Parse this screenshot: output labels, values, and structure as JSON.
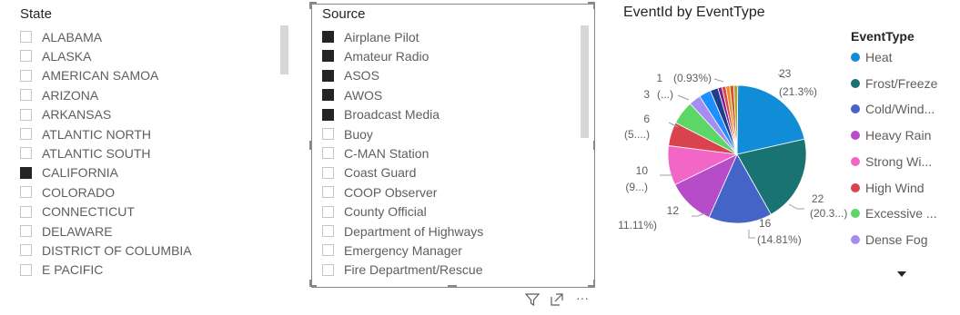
{
  "state_slicer": {
    "title": "State",
    "items": [
      {
        "label": "ALABAMA",
        "checked": false
      },
      {
        "label": "ALASKA",
        "checked": false
      },
      {
        "label": "AMERICAN SAMOA",
        "checked": false
      },
      {
        "label": "ARIZONA",
        "checked": false
      },
      {
        "label": "ARKANSAS",
        "checked": false
      },
      {
        "label": "ATLANTIC NORTH",
        "checked": false
      },
      {
        "label": "ATLANTIC SOUTH",
        "checked": false
      },
      {
        "label": "CALIFORNIA",
        "checked": true
      },
      {
        "label": "COLORADO",
        "checked": false
      },
      {
        "label": "CONNECTICUT",
        "checked": false
      },
      {
        "label": "DELAWARE",
        "checked": false
      },
      {
        "label": "DISTRICT OF COLUMBIA",
        "checked": false
      },
      {
        "label": "E PACIFIC",
        "checked": false
      }
    ]
  },
  "source_slicer": {
    "title": "Source",
    "items": [
      {
        "label": "Airplane Pilot",
        "checked": true
      },
      {
        "label": "Amateur Radio",
        "checked": true
      },
      {
        "label": "ASOS",
        "checked": true
      },
      {
        "label": "AWOS",
        "checked": true
      },
      {
        "label": "Broadcast Media",
        "checked": true
      },
      {
        "label": "Buoy",
        "checked": false
      },
      {
        "label": "C-MAN Station",
        "checked": false
      },
      {
        "label": "Coast Guard",
        "checked": false
      },
      {
        "label": "COOP Observer",
        "checked": false
      },
      {
        "label": "County Official",
        "checked": false
      },
      {
        "label": "Department of Highways",
        "checked": false
      },
      {
        "label": "Emergency Manager",
        "checked": false
      },
      {
        "label": "Fire Department/Rescue",
        "checked": false
      }
    ]
  },
  "visual_header": {
    "filter_icon": "filter-icon",
    "focus_icon": "focus-mode-icon",
    "more_icon": "more-options-icon",
    "more_glyph": "···"
  },
  "chart_data": {
    "type": "pie",
    "title": "EventId by EventType",
    "legend_title": "EventType",
    "legend_position": "right",
    "legend_entries": [
      {
        "label": "Heat",
        "color": "#118DD8"
      },
      {
        "label": "Frost/Freeze",
        "color": "#1A7373"
      },
      {
        "label": "Cold/Wind...",
        "color": "#4464C8"
      },
      {
        "label": "Heavy Rain",
        "color": "#B74CC8"
      },
      {
        "label": "Strong Wi...",
        "color": "#F266C8"
      },
      {
        "label": "High Wind",
        "color": "#D9434D"
      },
      {
        "label": "Excessive ...",
        "color": "#5BD667"
      },
      {
        "label": "Dense Fog",
        "color": "#A58CF0"
      }
    ],
    "legend_more_icon": "caret-down-icon",
    "slices": [
      {
        "category": "Heat",
        "value": 23,
        "percent_label": "(21.3%)",
        "color": "#118DD8"
      },
      {
        "category": "Frost/Freeze",
        "value": 22,
        "percent_label": "(20.3...)",
        "color": "#1A7373"
      },
      {
        "category": "Cold/Wind...",
        "value": 16,
        "percent_label": "(14.81%)",
        "color": "#4464C8"
      },
      {
        "category": "Heavy Rain",
        "value": 12,
        "percent_label": "(11.11%)",
        "color": "#B74CC8"
      },
      {
        "category": "Strong Wi...",
        "value": 10,
        "percent_label": "(9...)",
        "color": "#F266C8"
      },
      {
        "category": "High Wind",
        "value": 6,
        "percent_label": "(5....)",
        "color": "#D9434D"
      },
      {
        "category": "Excessive ...",
        "value": 6,
        "percent_label": "",
        "color": "#5BD667"
      },
      {
        "category": "Dense Fog",
        "value": 3,
        "percent_label": "(...)",
        "color": "#A58CF0"
      },
      {
        "category": "",
        "value": 3,
        "percent_label": "",
        "color": "#1F8FFF"
      },
      {
        "category": "",
        "value": 2,
        "percent_label": "",
        "color": "#203C8C"
      },
      {
        "category": "",
        "value": 1,
        "percent_label": "",
        "color": "#7A1F8C"
      },
      {
        "category": "",
        "value": 1,
        "percent_label": "",
        "color": "#E04848"
      },
      {
        "category": "",
        "value": 1,
        "percent_label": "",
        "color": "#F08C22"
      },
      {
        "category": "",
        "value": 1,
        "percent_label": "(0.93%)",
        "color": "#C85A2E"
      },
      {
        "category": "",
        "value": 1,
        "percent_label": "",
        "color": "#B8A02A"
      }
    ],
    "data_labels": [
      {
        "value": "23",
        "percent": "(21.3%)"
      },
      {
        "value": "22",
        "percent": "(20.3...)"
      },
      {
        "value": "16",
        "percent": "(14.81%)"
      },
      {
        "value": "12",
        "percent": "(11.11%)"
      },
      {
        "value": "10",
        "percent": "(9...)"
      },
      {
        "value": "6",
        "percent": "(5....)"
      },
      {
        "value": "3",
        "percent": "(...)"
      },
      {
        "value": "1",
        "percent": "(0.93%)"
      }
    ]
  }
}
